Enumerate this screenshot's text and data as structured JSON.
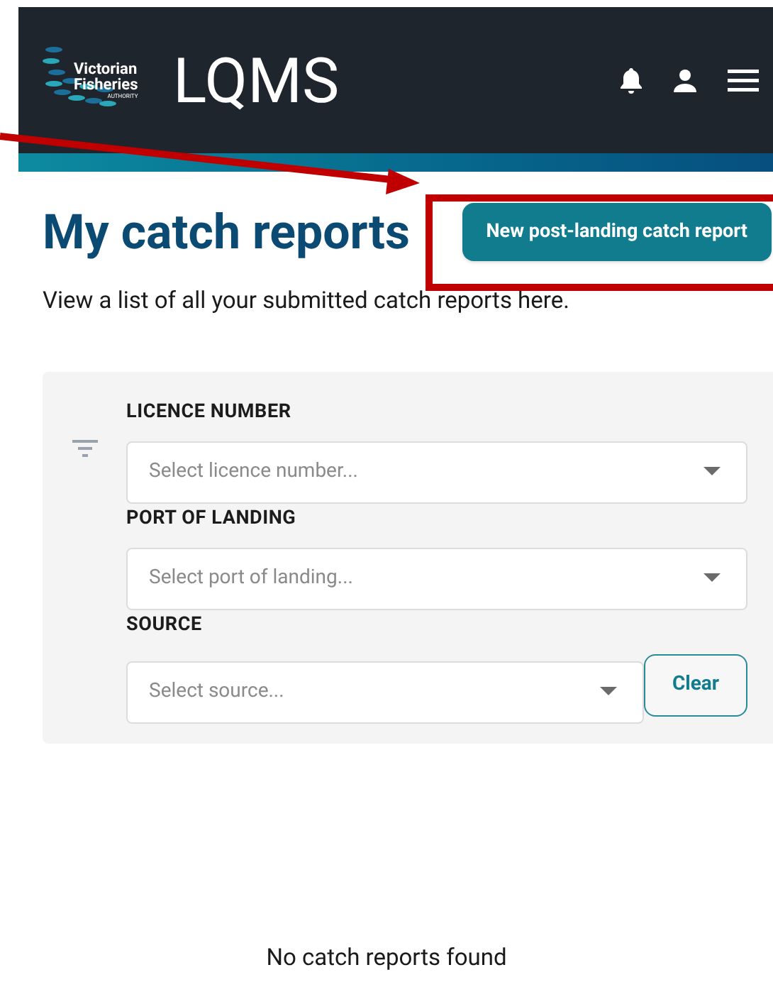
{
  "header": {
    "logo": {
      "line1": "Victorian",
      "line2": "Fisheries",
      "line3": "AUTHORITY"
    },
    "app_name": "LQMS"
  },
  "page": {
    "title": "My catch reports",
    "primary_button": "New post-landing catch report",
    "description": "View a list of all your submitted catch reports here."
  },
  "filters": [
    {
      "label": "LICENCE NUMBER",
      "placeholder": "Select licence number..."
    },
    {
      "label": "PORT OF LANDING",
      "placeholder": "Select port of landing..."
    },
    {
      "label": "SOURCE",
      "placeholder": "Select source..."
    }
  ],
  "clear_button": "Clear",
  "empty_message": "No catch reports found"
}
